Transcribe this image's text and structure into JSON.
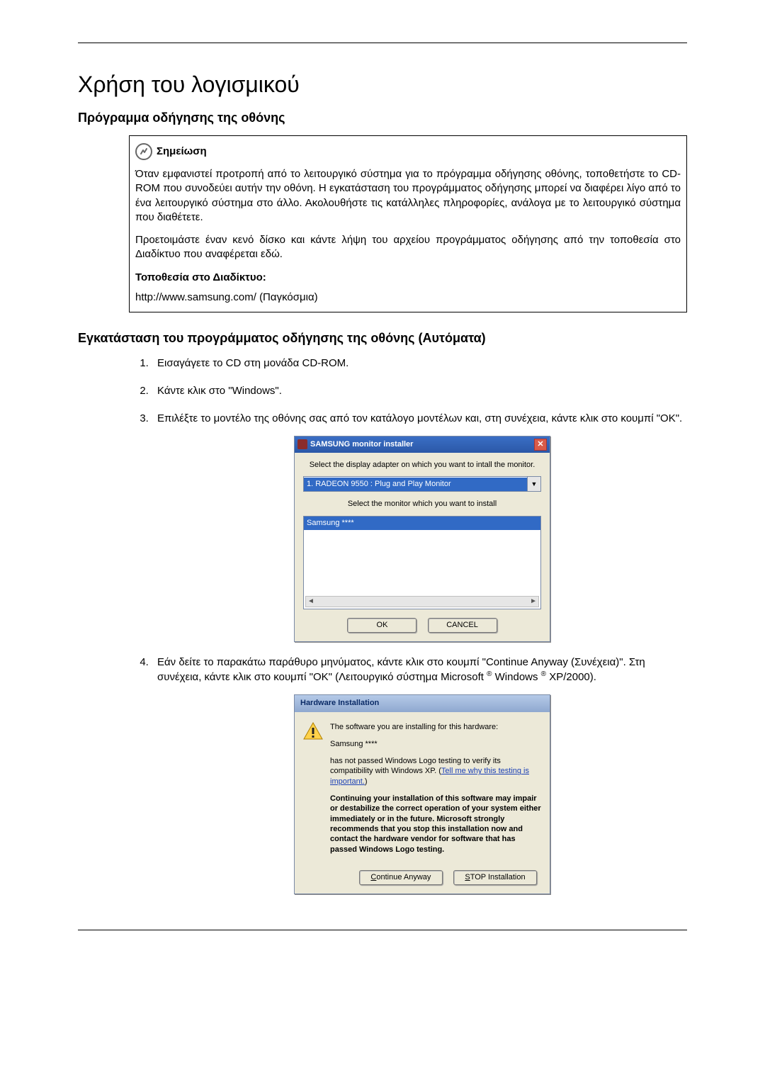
{
  "h1": "Χρήση του λογισμικού",
  "h2_1": "Πρόγραμμα οδήγησης της οθόνης",
  "note": {
    "title": "Σημείωση",
    "p1": "Όταν εμφανιστεί προτροπή από το λειτουργικό σύστημα για το πρόγραμμα οδήγησης οθόνης, τοποθετήστε το CD-ROM που συνοδεύει αυτήν την οθόνη. Η εγκατάσταση του προγράμματος οδήγησης μπορεί να διαφέρει λίγο από το ένα λειτουργικό σύστημα στο άλλο. Ακολουθήστε τις κατάλληλες πληροφορίες, ανάλογα με το λειτουργικό σύστημα που διαθέτετε.",
    "p2": "Προετοιμάστε έναν κενό δίσκο και κάντε λήψη του αρχείου προγράμματος οδήγησης από την τοποθεσία στο Διαδίκτυο που αναφέρεται εδώ.",
    "loc_label": "Τοποθεσία στο Διαδίκτυο:",
    "url": "http://www.samsung.com/ (Παγκόσμια)"
  },
  "h2_2": "Εγκατάσταση του προγράμματος οδήγησης της οθόνης (Αυτόματα)",
  "steps": {
    "s1": "Εισαγάγετε το CD στη μονάδα CD-ROM.",
    "s2": "Κάντε κλικ στο \"Windows\".",
    "s3": "Επιλέξτε το μοντέλο της οθόνης σας από τον κατάλογο μοντέλων και, στη συνέχεια, κάντε κλικ στο κουμπί \"OK\".",
    "s4_a": "Εάν δείτε το παρακάτω παράθυρο μηνύματος, κάντε κλικ στο κουμπί \"Continue Anyway (Συνέχεια)\". Στη συνέχεια, κάντε κλικ στο κουμπί \"OK\" (Λειτουργικό σύστημα Microsoft ",
    "s4_b": " Windows ",
    "s4_c": " XP/2000).",
    "reg": "®"
  },
  "dlg1": {
    "title": "SAMSUNG monitor installer",
    "label1": "Select the display adapter on which you want to intall the monitor.",
    "adapter": "1. RADEON 9550 : Plug and Play Monitor",
    "label2": "Select the monitor which you want to install",
    "model": "Samsung ****",
    "ok": "OK",
    "cancel": "CANCEL"
  },
  "dlg2": {
    "title": "Hardware Installation",
    "p1": "The software you are installing for this hardware:",
    "p2": "Samsung ****",
    "p3a": "has not passed Windows Logo testing to verify its compatibility with Windows XP. (",
    "link": "Tell me why this testing is important.",
    "p3b": ")",
    "p4": "Continuing your installation of this software may impair or destabilize the correct operation of your system either immediately or in the future. Microsoft strongly recommends that you stop this installation now and contact the hardware vendor for software that has passed Windows Logo testing.",
    "btn_continue": "Continue Anyway",
    "btn_stop": "STOP Installation"
  }
}
